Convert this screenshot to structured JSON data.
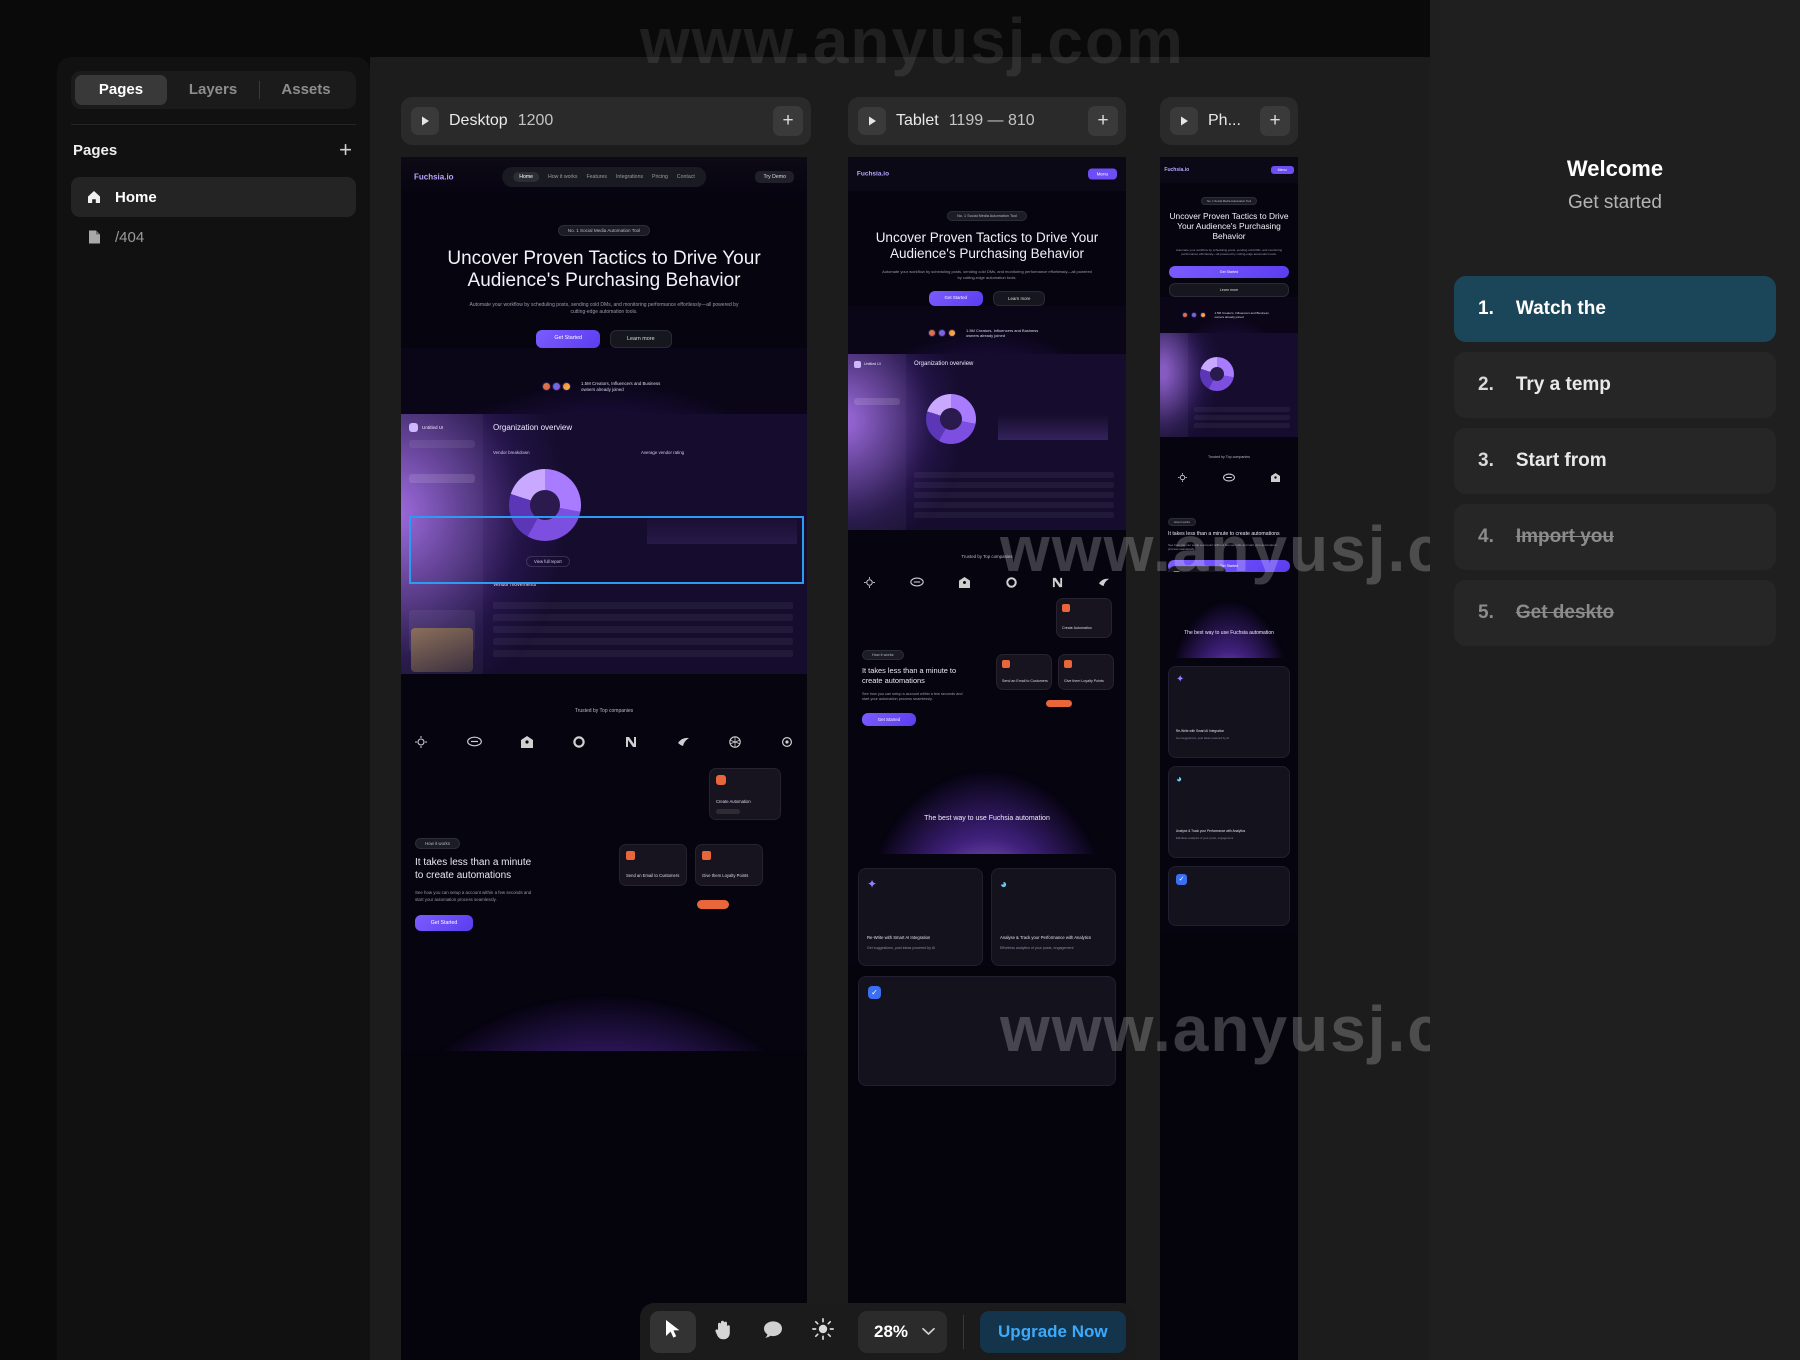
{
  "watermark": {
    "text": "www.anyusj.com"
  },
  "sidebar": {
    "tabs": [
      {
        "label": "Pages",
        "active": true
      },
      {
        "label": "Layers",
        "active": false
      },
      {
        "label": "Assets",
        "active": false
      }
    ],
    "section_title": "Pages",
    "add_icon": "plus-icon",
    "pages": [
      {
        "label": "Home",
        "icon": "home-icon",
        "selected": true
      },
      {
        "label": "/404",
        "icon": "file-icon",
        "selected": false
      }
    ]
  },
  "canvas": {
    "frames": [
      {
        "name": "Desktop",
        "dimensions": "1200",
        "play_icon": "play-icon",
        "add_icon": "plus-icon"
      },
      {
        "name": "Tablet",
        "dimensions": "1199 — 810",
        "play_icon": "play-icon",
        "add_icon": "plus-icon"
      },
      {
        "name": "Ph...",
        "dimensions": "",
        "play_icon": "play-icon",
        "add_icon": "plus-icon"
      }
    ]
  },
  "site": {
    "brand": "Fuchsia.io",
    "nav": [
      "Home",
      "How it works",
      "Features",
      "Integrations",
      "Pricing",
      "Contact"
    ],
    "nav_cta": "Try Demo",
    "nav_cta_mobile": "Menu",
    "hero_badge": "No. 1 Social Media Automation Tool",
    "hero_title": "Uncover Proven Tactics to Drive Your Audience's Purchasing Behavior",
    "hero_sub": "Automate your workflow by scheduling posts, sending cold DMs, and monitoring performance effortlessly—all powered by cutting-edge automation tools.",
    "hero_btn_primary": "Get Started",
    "hero_btn_secondary": "Learn more",
    "social_proof": "1.5M Creators, Influencers and Business owners already joined",
    "dashboard_title": "Organization overview",
    "dashboard_brand": "Untitled UI",
    "dashboard_card1": "Vendor breakdown",
    "dashboard_card2": "Average vendor rating",
    "dashboard_cta": "View full report",
    "dashboard_section": "Vendor movements",
    "trusted_label": "Trusted by Top companies",
    "auto_badge": "How it works",
    "auto_title": "It takes less than a minute to create automations",
    "auto_sub": "See how you can setup a account within a few seconds and start your automation process seamlessly.",
    "auto_btn": "Get Started",
    "mini_card_1": "Create Automation",
    "mini_card_2": "Send an Email to Customers",
    "mini_card_3": "Give them Loyalty Points",
    "best_way_title": "The best way to use Fuchsia automation",
    "feature_1_title": "Re-Write with Smart AI Integration",
    "feature_1_sub": "Get suggestions, post ideas powered by AI",
    "feature_2_title": "Analyse & Track your Performance with Analytics",
    "feature_2_sub": "Effortless analytics of your posts, engagement"
  },
  "right_panel": {
    "title": "Welcome",
    "subtitle": "Get started",
    "items": [
      {
        "num": "1.",
        "label": "Watch the",
        "state": "active"
      },
      {
        "num": "2.",
        "label": "Try a temp",
        "state": "default"
      },
      {
        "num": "3.",
        "label": "Start from",
        "state": "default"
      },
      {
        "num": "4.",
        "label": "Import you",
        "state": "done"
      },
      {
        "num": "5.",
        "label": "Get deskto",
        "state": "done"
      }
    ]
  },
  "toolbar": {
    "tools": [
      {
        "name": "cursor-tool",
        "icon": "cursor-icon",
        "active": true
      },
      {
        "name": "hand-tool",
        "icon": "hand-icon",
        "active": false
      },
      {
        "name": "comment-tool",
        "icon": "comment-icon",
        "active": false
      },
      {
        "name": "theme-tool",
        "icon": "sun-icon",
        "active": false
      }
    ],
    "zoom": "28%",
    "zoom_caret": "chevron-down-icon",
    "upgrade": "Upgrade Now"
  },
  "colors": {
    "accent_blue": "#3da9fb",
    "selection": "#2b9bf4",
    "purple": "#6d4df6",
    "active_item_bg": "#1b4659"
  }
}
